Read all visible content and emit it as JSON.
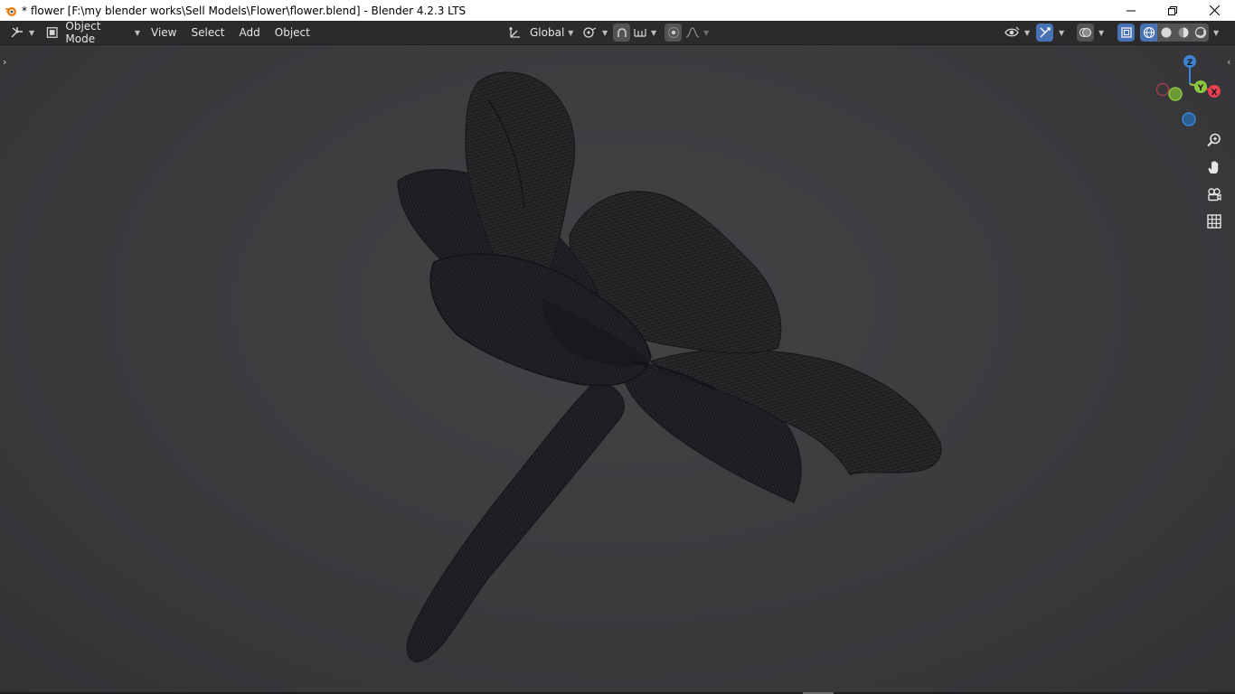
{
  "window": {
    "title": "* flower [F:\\my blender works\\Sell Models\\Flower\\flower.blend] - Blender 4.2.3 LTS"
  },
  "header": {
    "mode": "Object Mode",
    "menus": [
      "View",
      "Select",
      "Add",
      "Object"
    ],
    "transform_orientation": "Global"
  },
  "gizmo": {
    "z": "Z",
    "y": "Y",
    "x": "X"
  },
  "colors": {
    "accent": "#4772b3",
    "axis_x": "#e8404f",
    "axis_y": "#8dc63f",
    "axis_z": "#3d84d4"
  },
  "icons": {
    "window": [
      "blender-logo-icon",
      "minimize-icon",
      "restore-icon",
      "close-icon"
    ],
    "header": [
      "editor-type-icon",
      "object-mode-icon",
      "transform-orientation-icon",
      "pivot-point-icon",
      "snap-icon",
      "snap-increment-icon",
      "proportional-editing-icon",
      "falloff-icon",
      "visibility-icon",
      "gizmo-icon",
      "overlay-icon",
      "xray-icon",
      "wireframe-shading-icon",
      "solid-shading-icon",
      "material-shading-icon",
      "rendered-shading-icon"
    ],
    "navigation": [
      "zoom-icon",
      "pan-hand-icon",
      "camera-view-icon",
      "ortho-grid-icon"
    ]
  }
}
